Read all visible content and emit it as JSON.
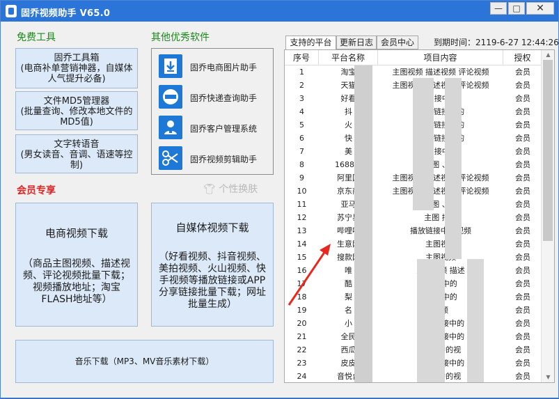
{
  "window": {
    "title": "固乔视频助手 V65.0",
    "min_glyph": "—",
    "max_glyph": "□",
    "close_glyph": "✕"
  },
  "free_tools": {
    "title": "免费工具",
    "items": [
      {
        "name": "固乔工具箱",
        "desc": "(电商补单营销神器，自媒体人气提升必备)"
      },
      {
        "name": "文件MD5管理器",
        "desc": "(批量查询、修改本地文件的MD5值)"
      },
      {
        "name": "文字转语音",
        "desc": "(男女读音、音调、语速等控制)"
      }
    ]
  },
  "other_software": {
    "title": "其他优秀软件",
    "items": [
      {
        "label": "固乔电商图片助手",
        "icon": "download-icon"
      },
      {
        "label": "固乔快递查询助手",
        "icon": "express-query-icon"
      },
      {
        "label": "固乔客户管理系统",
        "icon": "customer-icon"
      },
      {
        "label": "固乔视频剪辑助手",
        "icon": "scissors-icon"
      }
    ]
  },
  "vip": {
    "title": "会员专享",
    "skin_label": "个性换肤",
    "ecommerce": {
      "head": "电商视频下载",
      "desc": "（商品主图视频、描述视频、评论视频批量下载；视频播放地址；淘宝FLASH地址等）"
    },
    "media": {
      "head": "自媒体视频下载",
      "desc": "（好看视频、抖音视频、美拍视频、火山视频、快手视频等播放链接或APP分享链接批量下载；网址批量生成）"
    },
    "music": "音乐下载（MP3、MV音乐素材下载）"
  },
  "tabs": [
    "支持的平台",
    "更新日志",
    "会员中心"
  ],
  "expire_text": "到期时间：2119-6-27 12:44:26",
  "table": {
    "headers": [
      "序号",
      "平台名称",
      "项目内容",
      "授权"
    ],
    "rows": [
      [
        "1",
        "淘宝",
        "主图视频 描述视频 评论视频",
        "会员"
      ],
      [
        "2",
        "天猫",
        "主图视频 描述视频 评论视频",
        "会员"
      ],
      [
        "3",
        "好看",
        "播 接中的",
        "会员"
      ],
      [
        "4",
        "抖",
        "APP 链接中的",
        "会员"
      ],
      [
        "5",
        "火",
        "APP 链接中的",
        "会员"
      ],
      [
        "6",
        "快",
        "APP 链接中的",
        "会员"
      ],
      [
        "7",
        "美",
        "播 接中的",
        "会员"
      ],
      [
        "8",
        "1688中",
        "主图 、描",
        "会员"
      ],
      [
        "9",
        "阿里国",
        "主图视频 描述视频 评论视频",
        "会员"
      ],
      [
        "10",
        "京东商",
        "主图视频 描述视频 评论视频",
        "会员"
      ],
      [
        "11",
        "亚马",
        "主图 、描",
        "会员"
      ],
      [
        "12",
        "苏宁易",
        "主图 描述",
        "会员"
      ],
      [
        "13",
        "哔哩哔",
        "播放链接中的视频",
        "会员"
      ],
      [
        "14",
        "生意网",
        "主图视频",
        "会员"
      ],
      [
        "15",
        "搜款网",
        "主图视频",
        "会员"
      ],
      [
        "16",
        "唯",
        "主图视频 描述",
        "会员"
      ],
      [
        "17",
        "酷",
        "播放 中的",
        "会员"
      ],
      [
        "18",
        "梨",
        "播放 中的",
        "会员"
      ],
      [
        "19",
        "名",
        "视频",
        "会员"
      ],
      [
        "20",
        "小",
        "APP分 接中的",
        "会员"
      ],
      [
        "21",
        "全民",
        "APP分 接中的",
        "会员"
      ],
      [
        "22",
        "西瓜",
        "播 接中的视",
        "会员"
      ],
      [
        "23",
        "皮皮",
        "APP分 接中的",
        "会员"
      ],
      [
        "24",
        "音悦台",
        "播 接中的视",
        "会员"
      ]
    ]
  },
  "colors": {
    "titlebar": "#2b74d8",
    "green_title": "#1a8a1a",
    "red_title": "#e02424",
    "button_bg": "#dbe9f8",
    "arrow": "#e8281f"
  }
}
